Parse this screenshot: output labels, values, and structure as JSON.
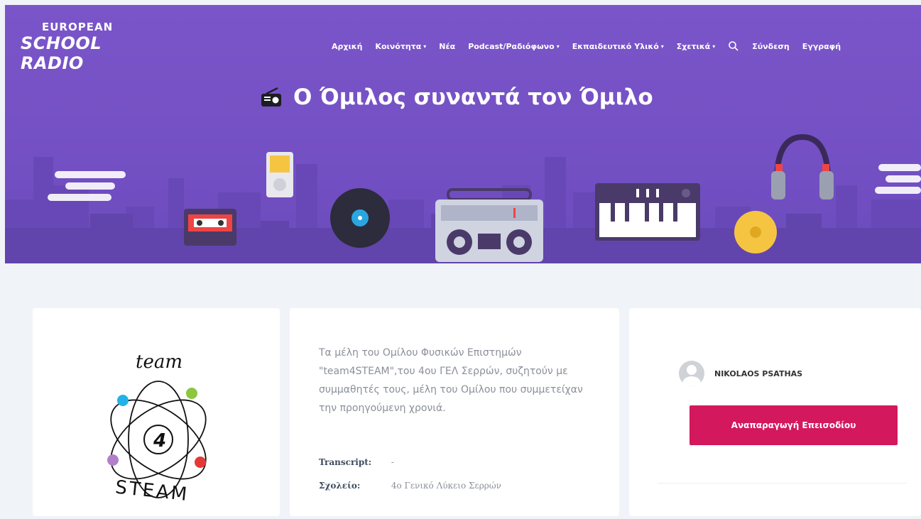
{
  "logo": {
    "line1": "EUROPEAN",
    "line2": "SCHOOL RADIO"
  },
  "nav": {
    "items": [
      {
        "label": "Αρχική",
        "caret": ""
      },
      {
        "label": "Κοινότητα",
        "caret": "▾"
      },
      {
        "label": "Νέα",
        "caret": ""
      },
      {
        "label": "Podcast/Ραδιόφωνο",
        "caret": "▾"
      },
      {
        "label": "Εκπαιδευτικό Υλικό",
        "caret": "▾"
      },
      {
        "label": "Σχετικά",
        "caret": "▾"
      }
    ],
    "search_icon": "search-icon",
    "login": "Σύνδεση",
    "register": "Εγγραφή"
  },
  "hero": {
    "title": "Ο Όμιλος συναντά τον Όμιλο",
    "icon": "radio-icon"
  },
  "episode_logo": {
    "top_text": "team",
    "center_text": "4",
    "bottom_text": "STEAM"
  },
  "episode": {
    "description": "Τα μέλη του Ομίλου Φυσικών Επιστημών \"team4STEAM\",του 4ου ΓΕΛ Σερρών, συζητούν με συμμαθητές τους, μέλη του Ομίλου που συμμετείχαν την προηγούμενη χρονιά.",
    "transcript_label": "Transcript:",
    "transcript_value": "-",
    "school_label": "Σχολείο:",
    "school_value": "4ο Γενικό Λύκειο Σερρών"
  },
  "sidebar": {
    "author": "NIKOLAOS PSATHAS",
    "play_button": "Αναπαραγωγή Επεισοδίου"
  },
  "colors": {
    "hero_bg": "#7652c5",
    "accent": "#d3185e",
    "page_bg": "#f0f3f7"
  }
}
